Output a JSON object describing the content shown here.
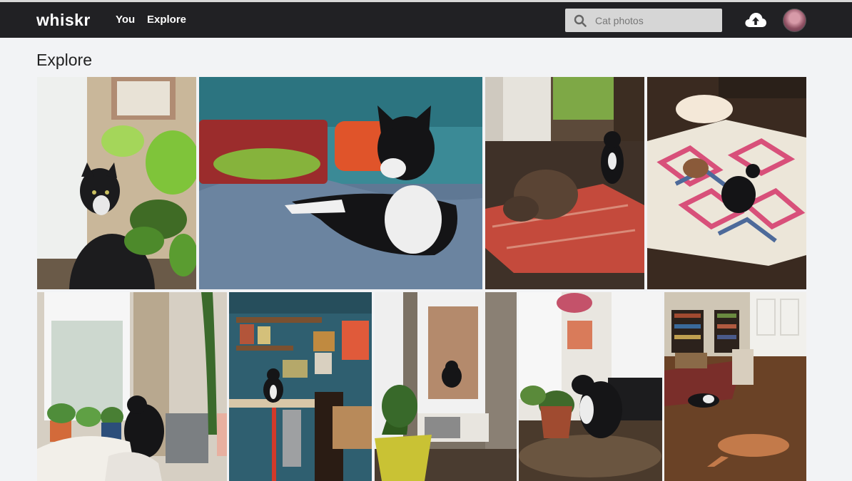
{
  "app": {
    "logo": "whiskr"
  },
  "nav": {
    "links": [
      "You",
      "Explore"
    ]
  },
  "search": {
    "placeholder": "Cat photos",
    "value": ""
  },
  "page": {
    "title": "Explore"
  },
  "photos": [
    "Cat behind pothos plant by window",
    "Black and white cat lounging on blue bed",
    "Cat and dog on red rug",
    "Cats on patterned rug",
    "Cat on sofa by window with plants",
    "Cat sitting on desk with shelves",
    "Cat on windowsill with plant",
    "Cat sniffing potted plant on table",
    "Cat and dog on wooden floor"
  ]
}
